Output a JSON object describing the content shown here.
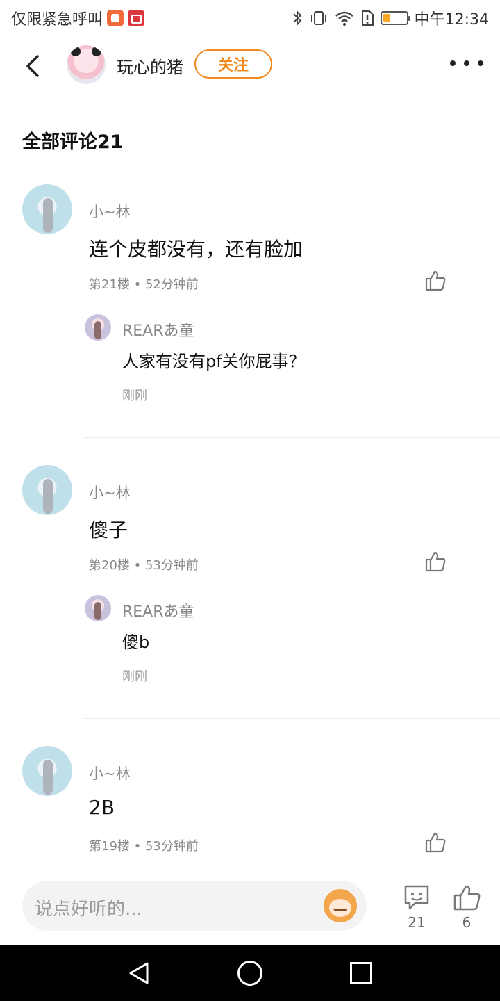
{
  "status_bar": {
    "left_text": "仅限紧急呼叫",
    "time": "中午12:34"
  },
  "header": {
    "user_name": "玩心的猪",
    "follow_label": "关注"
  },
  "section_title": "全部评论21",
  "comments": [
    {
      "name": "小~林",
      "text": "连个皮都没有，还有脸加",
      "meta": "第21楼 • 52分钟前",
      "reply": {
        "name": "REARあ童",
        "text": "人家有没有pf关你屁事？",
        "time": "刚刚"
      }
    },
    {
      "name": "小~林",
      "text": "傻子",
      "meta": "第20楼 • 53分钟前",
      "reply": {
        "name": "REARあ童",
        "text": "傻b",
        "time": "刚刚"
      }
    },
    {
      "name": "小~林",
      "text": "2B",
      "meta": "第19楼 • 53分钟前"
    }
  ],
  "bottom_bar": {
    "input_placeholder": "说点好听的...",
    "comment_count": "21",
    "like_count": "6"
  },
  "colors": {
    "accent": "#f08a1c"
  }
}
